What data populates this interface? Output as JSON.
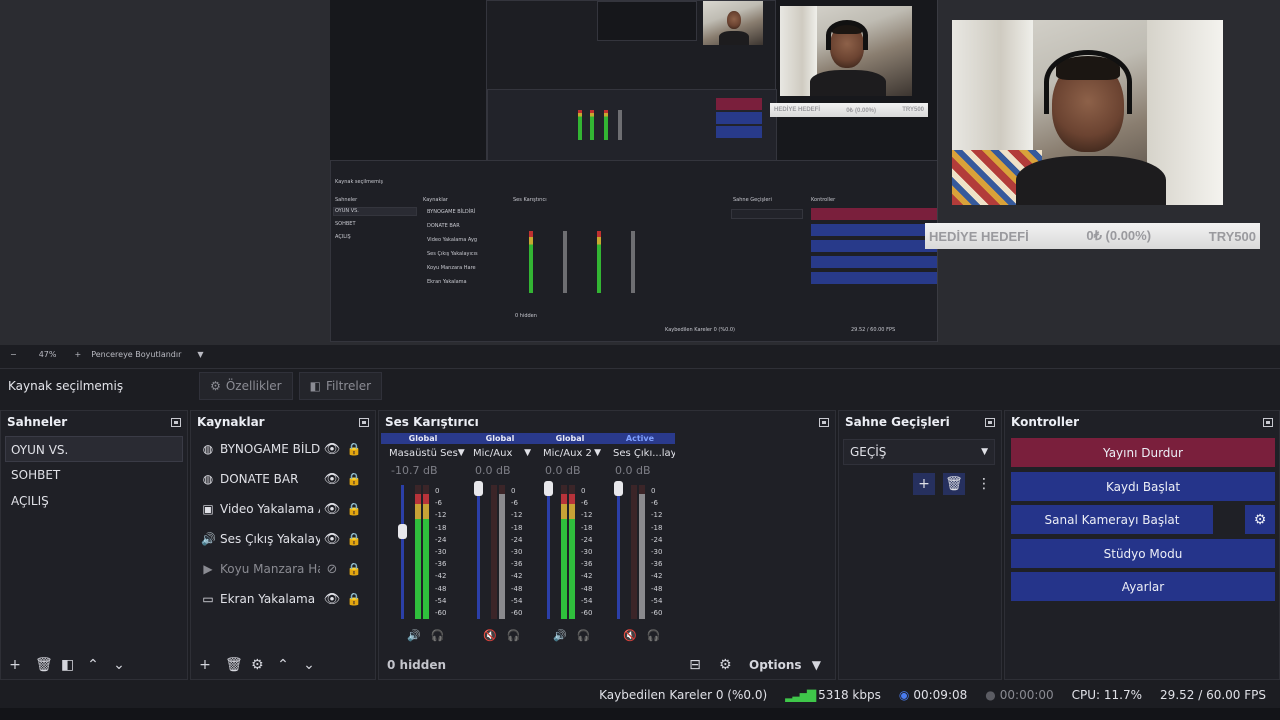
{
  "preview": {
    "goal_label": "HEDİYE HEDEFİ",
    "goal_value": "0₺ (0.00%)",
    "goal_target": "TRY500"
  },
  "preview_toolbar": {
    "zoom": "47%",
    "fit_label": "Pencereye Boyutlandır"
  },
  "source_bar": {
    "no_source": "Kaynak seçilmemiş",
    "properties": "Özellikler",
    "filters": "Filtreler"
  },
  "scenes": {
    "title": "Sahneler",
    "items": [
      "OYUN VS.",
      "SOHBET",
      "AÇILIŞ"
    ]
  },
  "sources": {
    "title": "Kaynaklar",
    "items": [
      {
        "label": "BYNOGAME BİLDİRİ",
        "icon": "globe-icon"
      },
      {
        "label": "DONATE BAR",
        "icon": "globe-icon"
      },
      {
        "label": "Video Yakalama Ayg",
        "icon": "camera-icon"
      },
      {
        "label": "Ses Çıkış Yakalayıcıs",
        "icon": "speaker-icon"
      },
      {
        "label": "Koyu Manzara Hare",
        "icon": "play-icon"
      },
      {
        "label": "Ekran Yakalama",
        "icon": "monitor-icon"
      }
    ]
  },
  "mixer": {
    "title": "Ses Karıştırıcı",
    "hidden": "0 hidden",
    "options": "Options",
    "ticks": [
      "0",
      "-6",
      "-12",
      "-18",
      "-24",
      "-30",
      "-36",
      "-42",
      "-48",
      "-54",
      "-60"
    ],
    "channels": [
      {
        "tag": "Global",
        "name": "Masaüstü Ses",
        "db": "-10.7 dB",
        "level": 0.32,
        "meter": 0.93,
        "muted": false
      },
      {
        "tag": "Global",
        "name": "Mic/Aux",
        "db": "0.0 dB",
        "level": 0.0,
        "meter": 0.93,
        "muted": true
      },
      {
        "tag": "Global",
        "name": "Mic/Aux 2",
        "db": "0.0 dB",
        "level": 0.0,
        "meter": 0.93,
        "muted": false
      },
      {
        "tag": "Active",
        "name": "Ses Çıkı...layıcısı",
        "db": "0.0 dB",
        "level": 0.0,
        "meter": 0.93,
        "muted": true
      }
    ]
  },
  "transitions": {
    "title": "Sahne Geçişleri",
    "selected": "GEÇİŞ"
  },
  "controls": {
    "title": "Kontroller",
    "stop_stream": "Yayını Durdur",
    "start_record": "Kaydı Başlat",
    "start_vcam": "Sanal Kamerayı Başlat",
    "studio_mode": "Stüdyo Modu",
    "settings": "Ayarlar"
  },
  "status": {
    "dropped": "Kaybedilen Kareler 0 (%0.0)",
    "bitrate": "5318 kbps",
    "stream_time": "00:09:08",
    "rec_time": "00:00:00",
    "cpu": "CPU: 11.7%",
    "fps": "29.52 / 60.00 FPS"
  },
  "colors": {
    "accent_blue": "#25348a",
    "stop_red": "#7a1f3c",
    "meter_green": "#2fbf3c"
  }
}
